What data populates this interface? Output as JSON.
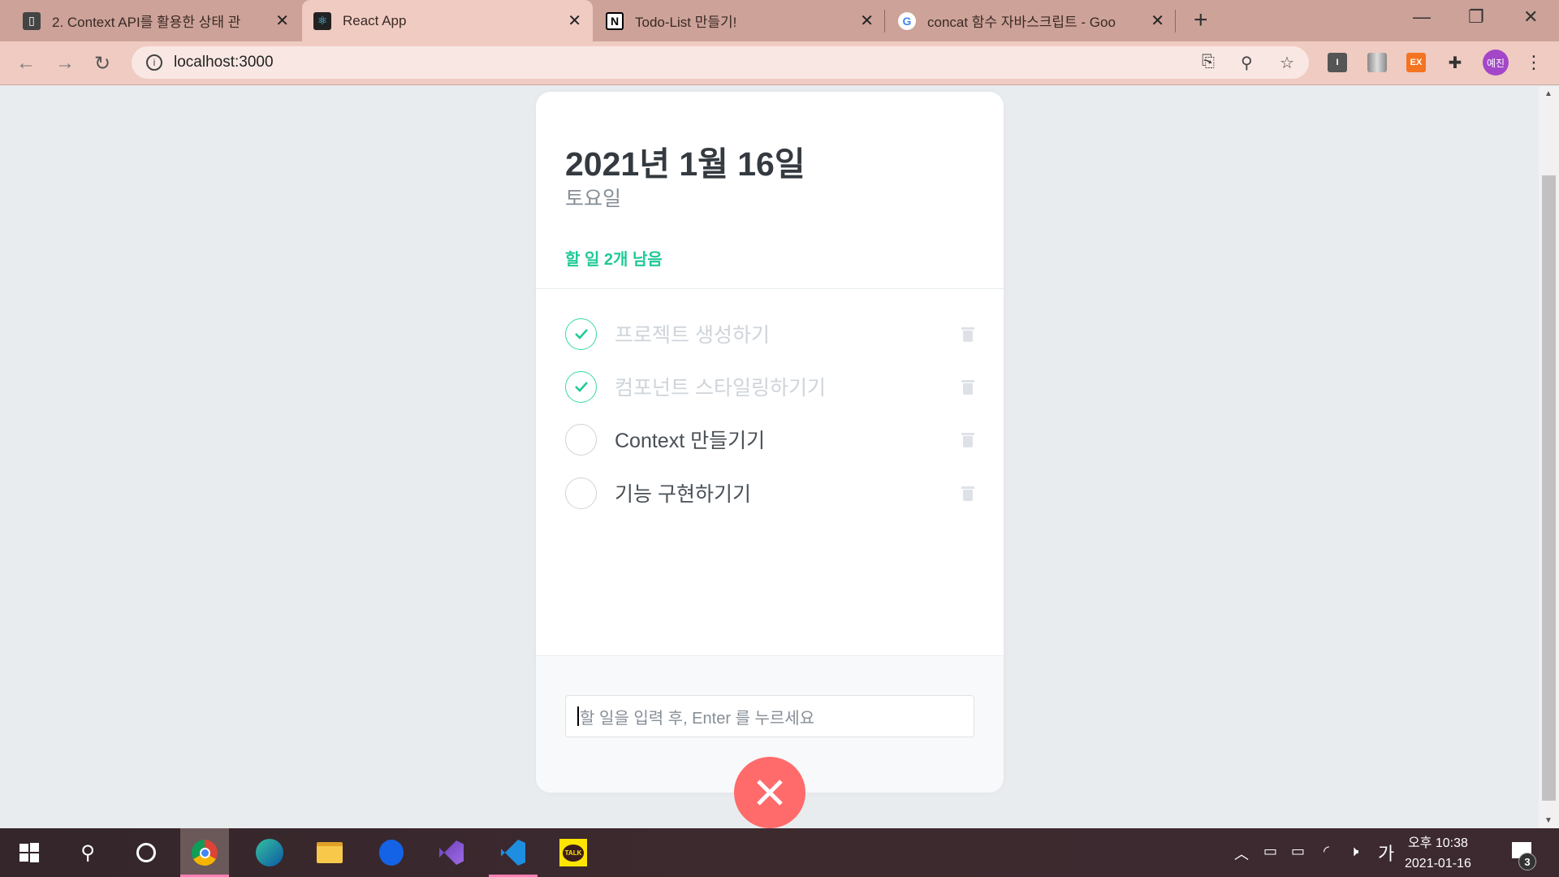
{
  "browser": {
    "tabs": [
      {
        "label": "2. Context API를 활용한 상태 관",
        "icon": "book-icon"
      },
      {
        "label": "React App",
        "icon": "react-icon",
        "active": true
      },
      {
        "label": "Todo-List 만들기!",
        "icon": "notion-icon"
      },
      {
        "label": "concat 함수 자바스크립트 - Goo",
        "icon": "google-icon"
      }
    ],
    "url": "localhost:3000",
    "profile": "예진",
    "ext_ex": "EX"
  },
  "app": {
    "date": "2021년 1월 16일",
    "day": "토요일",
    "tasks_left": "할 일 2개 남음",
    "todos": [
      {
        "text": "프로젝트 생성하기",
        "done": true
      },
      {
        "text": "컴포넌트 스타일링하기기",
        "done": true
      },
      {
        "text": "Context 만들기기",
        "done": false
      },
      {
        "text": "기능 구현하기기",
        "done": false
      }
    ],
    "input_placeholder": "할 일을 입력 후, Enter 를 누르세요",
    "accent": "#20c997",
    "close_color": "#ff6b6b"
  },
  "taskbar": {
    "time": "오후 10:38",
    "date": "2021-01-16",
    "ime": "가",
    "notifications": "3",
    "kakao": "TALK"
  }
}
